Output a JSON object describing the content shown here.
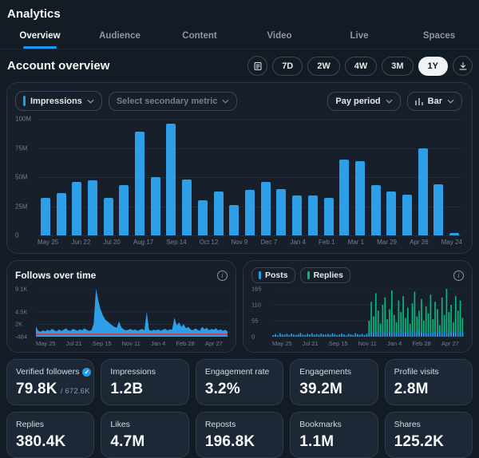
{
  "header": {
    "title": "Analytics"
  },
  "tabs": [
    {
      "label": "Overview",
      "active": true
    },
    {
      "label": "Audience",
      "active": false
    },
    {
      "label": "Content",
      "active": false
    },
    {
      "label": "Video",
      "active": false
    },
    {
      "label": "Live",
      "active": false
    },
    {
      "label": "Spaces",
      "active": false
    }
  ],
  "section": {
    "title": "Account overview"
  },
  "range_buttons": {
    "options": [
      "7D",
      "2W",
      "4W",
      "3M",
      "1Y"
    ],
    "active": "1Y"
  },
  "icons": {
    "summary": "calendar-list-icon",
    "download": "download-icon",
    "chevron": "chevron-down-icon",
    "chart_type": "bar-chart-icon",
    "info": "info-icon",
    "verified": "verified-badge-icon"
  },
  "chart_controls": {
    "primary_metric": "Impressions",
    "secondary_metric_placeholder": "Select secondary metric",
    "period": "Pay period",
    "chart_type": "Bar"
  },
  "colors": {
    "accent_blue": "#1d9bf0",
    "bar_blue": "#2d9fe8",
    "replies_green": "#00ba7c",
    "negative_red": "#f4212e",
    "active_pill_bg": "#eff3f4",
    "active_pill_text": "#0f1419"
  },
  "chart_data": [
    {
      "id": "impressions-by-pay-period",
      "type": "bar",
      "metric": "Impressions",
      "unit": "millions",
      "ylim": [
        0,
        100
      ],
      "y_ticks": [
        "100M",
        "75M",
        "50M",
        "25M",
        "0"
      ],
      "x_tick_labels": [
        "May 25",
        "Jun 22",
        "Jul 20",
        "Aug 17",
        "Sep 14",
        "Oct 12",
        "Nov 9",
        "Dec 7",
        "Jan 4",
        "Feb 1",
        "Mar 1",
        "Mar 29",
        "Apr 26",
        "May 24"
      ],
      "values": [
        32,
        36,
        46,
        47,
        32,
        43,
        89,
        50,
        96,
        48,
        30,
        38,
        26,
        39,
        46,
        40,
        34,
        34,
        32,
        65,
        64,
        43,
        38,
        35,
        75,
        44,
        2
      ],
      "bar_color": "#2d9fe8",
      "grid": true,
      "legend_position": "none"
    },
    {
      "id": "follows-over-time",
      "type": "area",
      "title": "Follows over time",
      "color": "#2d9fe8",
      "zero_line_color": "#f4212e",
      "ylim": [
        -484,
        9100
      ],
      "y_ticks": [
        "9.1K",
        "4.5K",
        "2K",
        "-484"
      ],
      "y_tick_values": [
        9100,
        4500,
        2000,
        -484
      ],
      "x_tick_labels": [
        "May 25",
        "Jul 21",
        "Sep 15",
        "Nov 11",
        "Jan 4",
        "Feb 28",
        "Apr 27"
      ],
      "values": [
        1600,
        700,
        500,
        800,
        600,
        900,
        700,
        1100,
        800,
        600,
        1000,
        700,
        900,
        1200,
        800,
        700,
        1100,
        900,
        700,
        1000,
        800,
        1200,
        900,
        700,
        800,
        2000,
        9100,
        6800,
        5000,
        3800,
        3000,
        2600,
        2200,
        1800,
        1500,
        1300,
        2600,
        1400,
        1000,
        800,
        900,
        1100,
        800,
        1000,
        700,
        900,
        1100,
        800,
        4500,
        900,
        700,
        900,
        800,
        1000,
        700,
        900,
        1100,
        800,
        1000,
        900,
        3300,
        1800,
        2400,
        1500,
        2000,
        1200,
        1500,
        1000,
        800,
        1200,
        900,
        700,
        1500,
        1000,
        1300,
        800,
        1100,
        900,
        1200,
        800,
        1000,
        700,
        900,
        600
      ],
      "grid": true
    },
    {
      "id": "posts-and-replies",
      "type": "bar",
      "legend_position": "top",
      "ylim": [
        0,
        165
      ],
      "y_ticks": [
        "165",
        "110",
        "55",
        "0"
      ],
      "y_tick_values": [
        165,
        110,
        55,
        0
      ],
      "x_tick_labels": [
        "May 25",
        "Jul 21",
        "Sep 15",
        "Nov 11",
        "Jan 4",
        "Feb 28",
        "Apr 27"
      ],
      "series": [
        {
          "name": "Posts",
          "color": "#1d9bf0",
          "values": [
            6,
            9,
            5,
            12,
            8,
            7,
            10,
            6,
            11,
            8,
            5,
            9,
            13,
            7,
            6,
            10,
            8,
            12,
            5,
            9,
            7,
            11,
            6,
            8,
            10,
            7,
            12,
            9,
            6,
            8,
            11,
            7,
            5,
            10,
            8,
            6,
            12,
            9,
            7,
            10,
            6,
            8,
            14,
            18,
            12,
            20,
            15,
            10,
            22,
            16,
            12,
            18,
            14,
            20,
            11,
            16,
            24,
            13,
            18,
            15,
            21,
            12,
            17,
            14,
            25,
            16,
            11,
            19,
            13,
            22,
            15,
            18,
            12,
            20,
            14,
            17,
            23,
            13,
            19,
            15,
            21,
            12,
            16,
            18
          ]
        },
        {
          "name": "Replies",
          "color": "#00ba7c",
          "values": [
            3,
            5,
            2,
            6,
            4,
            3,
            7,
            2,
            5,
            4,
            6,
            3,
            8,
            4,
            2,
            6,
            5,
            3,
            7,
            4,
            2,
            5,
            8,
            3,
            6,
            4,
            7,
            2,
            5,
            3,
            6,
            8,
            4,
            2,
            7,
            5,
            3,
            6,
            4,
            8,
            5,
            10,
            55,
            120,
            70,
            150,
            90,
            45,
            110,
            135,
            60,
            95,
            160,
            75,
            50,
            125,
            85,
            140,
            65,
            100,
            45,
            115,
            155,
            70,
            90,
            130,
            55,
            105,
            80,
            145,
            60,
            120,
            95,
            40,
            135,
            75,
            165,
            85,
            110,
            50,
            140,
            90,
            125,
            65
          ]
        }
      ],
      "grid": true
    }
  ],
  "stats": [
    {
      "label": "Verified followers",
      "value": "79.8K",
      "suffix": "/ 672.6K",
      "badge": true
    },
    {
      "label": "Impressions",
      "value": "1.2B"
    },
    {
      "label": "Engagement rate",
      "value": "3.2%"
    },
    {
      "label": "Engagements",
      "value": "39.2M"
    },
    {
      "label": "Profile visits",
      "value": "2.8M"
    },
    {
      "label": "Replies",
      "value": "380.4K"
    },
    {
      "label": "Likes",
      "value": "4.7M"
    },
    {
      "label": "Reposts",
      "value": "196.8K"
    },
    {
      "label": "Bookmarks",
      "value": "1.1M"
    },
    {
      "label": "Shares",
      "value": "125.2K"
    }
  ]
}
